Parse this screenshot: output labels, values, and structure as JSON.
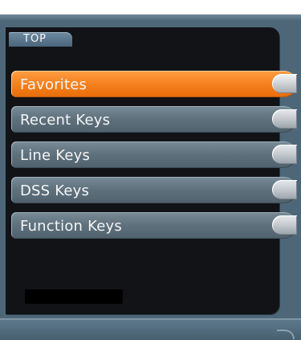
{
  "header": {
    "tab_label": "TOP"
  },
  "menu": {
    "items": [
      {
        "label": "Favorites",
        "selected": true
      },
      {
        "label": "Recent Keys",
        "selected": false
      },
      {
        "label": "Line Keys",
        "selected": false
      },
      {
        "label": "DSS Keys",
        "selected": false
      },
      {
        "label": "Function Keys",
        "selected": false
      }
    ]
  },
  "colors": {
    "selected_item": "#f5821f",
    "normal_item": "#5f717d",
    "panel_background": "#121317",
    "frame_background": "#4d6778"
  }
}
